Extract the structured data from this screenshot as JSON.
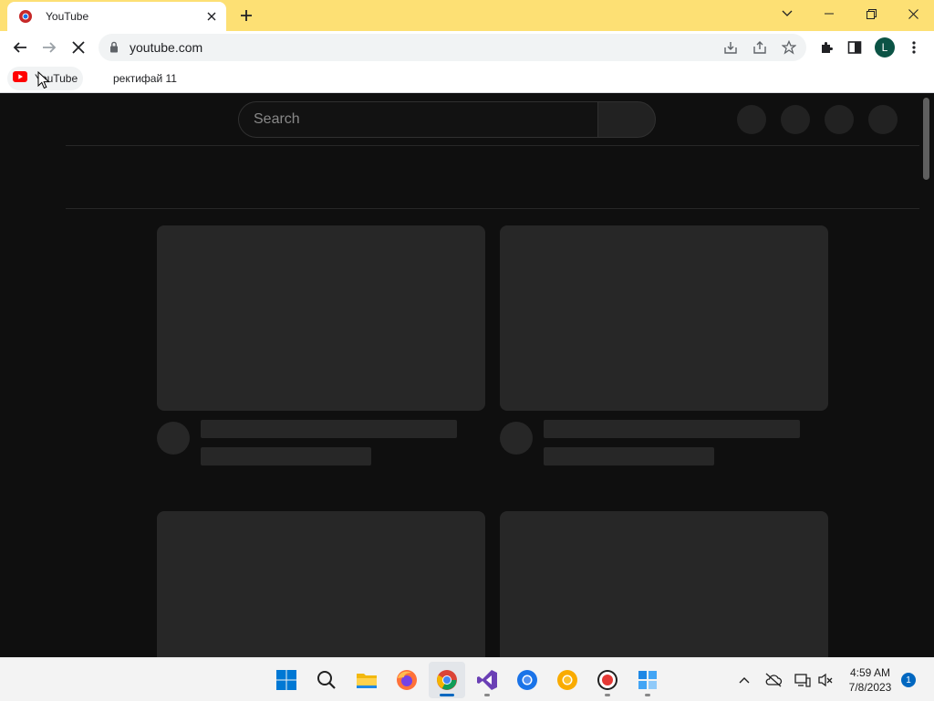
{
  "browser": {
    "tab": {
      "title": "YouTube"
    },
    "address": {
      "url": "youtube.com"
    },
    "profile_initial": "L",
    "bookmarks": [
      {
        "label": "YouTube"
      },
      {
        "label": "ректифай 11"
      }
    ]
  },
  "page": {
    "search": {
      "placeholder": "Search"
    }
  },
  "taskbar": {
    "clock": {
      "time": "4:59 AM",
      "date": "7/8/2023"
    },
    "notification_count": "1",
    "apps": [
      "start-icon",
      "search-icon",
      "file-explorer-icon",
      "firefox-icon",
      "chrome-icon",
      "visual-studio-icon",
      "chromium-icon",
      "chrome-canary-icon",
      "record-icon",
      "app-grid-icon"
    ]
  },
  "colors": {
    "titlebar": "#fde074",
    "page_bg": "#0f0f0f",
    "skeleton": "#272727",
    "youtube_red": "#ff0000",
    "profile": "#0b5345"
  }
}
